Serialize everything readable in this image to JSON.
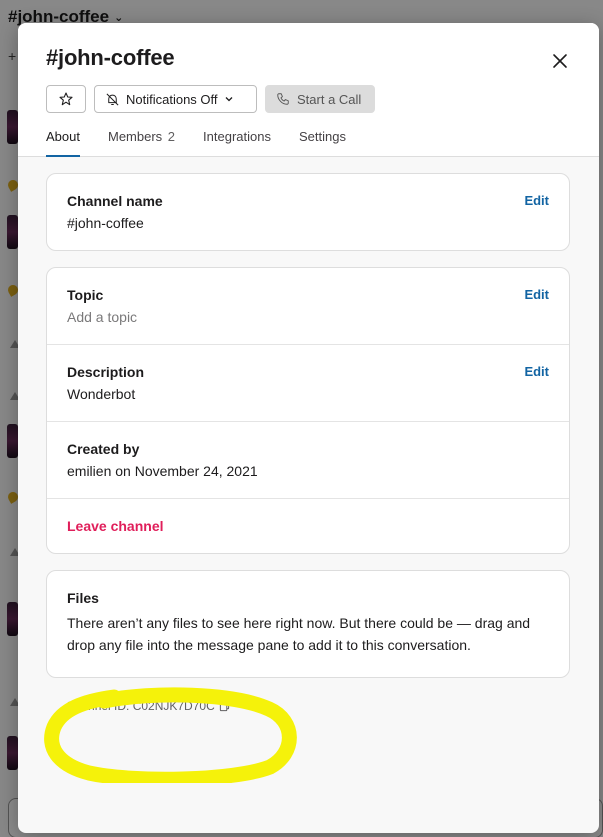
{
  "background": {
    "channel_header": "#john-coffee"
  },
  "modal": {
    "title": "#john-coffee",
    "buttons": {
      "notifications": "Notifications Off",
      "call": "Start a Call"
    },
    "tabs": [
      {
        "label": "About",
        "count": ""
      },
      {
        "label": "Members",
        "count": "2"
      },
      {
        "label": "Integrations",
        "count": ""
      },
      {
        "label": "Settings",
        "count": ""
      }
    ],
    "channel_name": {
      "label": "Channel name",
      "value": "#john-coffee",
      "edit": "Edit"
    },
    "topic": {
      "label": "Topic",
      "value": "Add a topic",
      "edit": "Edit"
    },
    "description": {
      "label": "Description",
      "value": "Wonderbot",
      "edit": "Edit"
    },
    "created": {
      "label": "Created by",
      "value": "emilien on November 24, 2021"
    },
    "leave": "Leave channel",
    "files": {
      "label": "Files",
      "body": "There aren’t any files to see here right now. But there could be — drag and drop any file into the message pane to add it to this conversation."
    },
    "channel_id": "Channel ID: C02NJK7D70C"
  },
  "colors": {
    "accent": "#1264a3",
    "danger": "#e01e5a",
    "highlight": "#f5f20a"
  },
  "icons": [
    "star-icon",
    "bell-off-icon",
    "chevron-down-icon",
    "phone-icon",
    "close-icon",
    "copy-icon"
  ]
}
